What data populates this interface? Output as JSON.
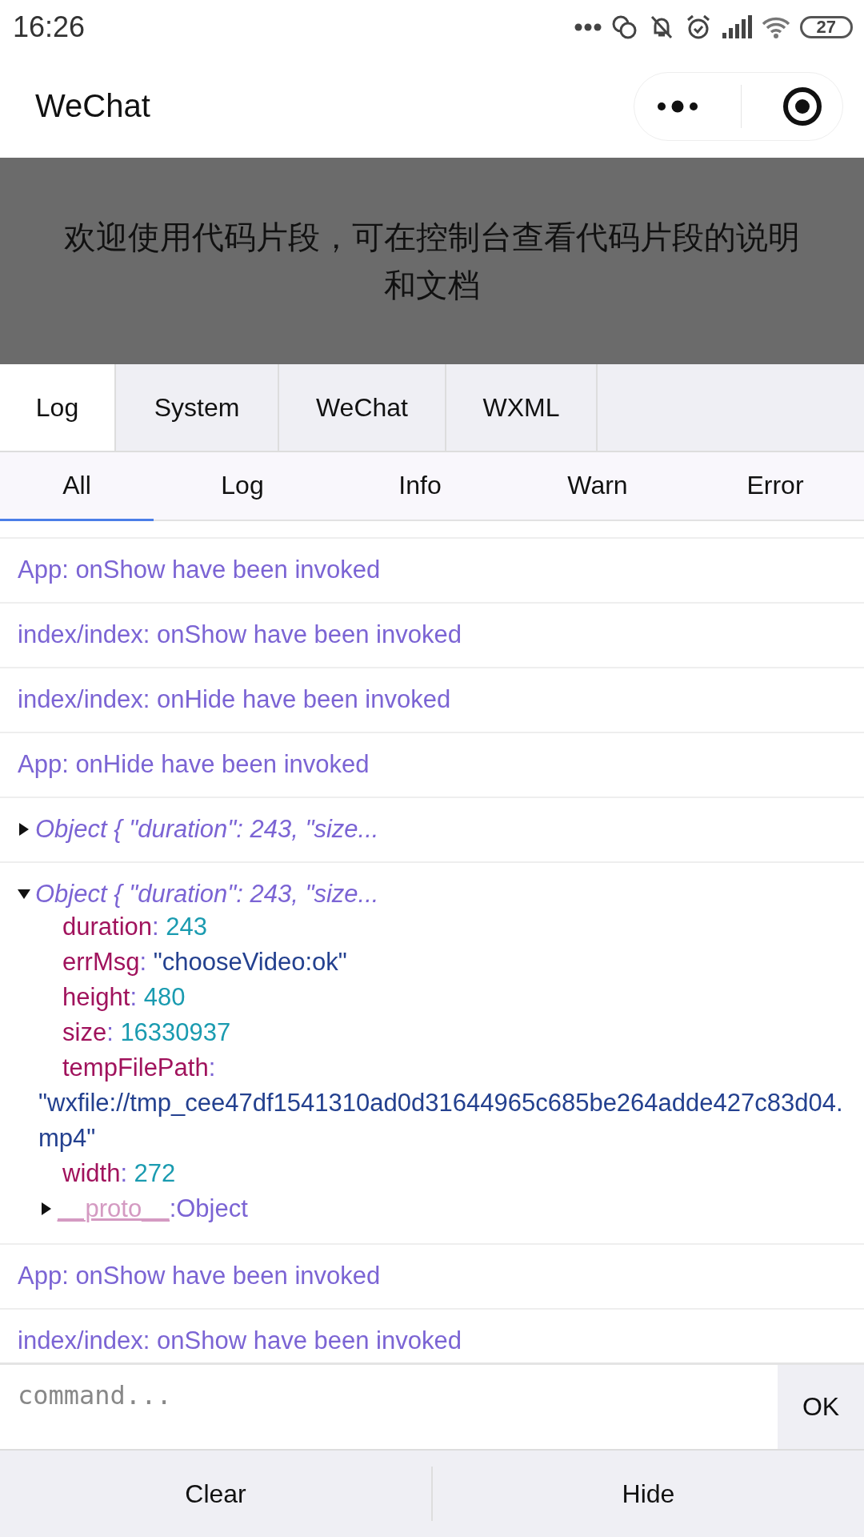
{
  "status_bar": {
    "time": "16:26",
    "battery": "27"
  },
  "nav": {
    "title": "WeChat"
  },
  "banner": {
    "text": "欢迎使用代码片段，可在控制台查看代码片段的说明和文档"
  },
  "tabs": [
    {
      "label": "Log",
      "selected": true
    },
    {
      "label": "System",
      "selected": false
    },
    {
      "label": "WeChat",
      "selected": false
    },
    {
      "label": "WXML",
      "selected": false
    }
  ],
  "filters": [
    {
      "label": "All",
      "selected": true
    },
    {
      "label": "Log",
      "selected": false
    },
    {
      "label": "Info",
      "selected": false
    },
    {
      "label": "Warn",
      "selected": false
    },
    {
      "label": "Error",
      "selected": false
    }
  ],
  "logs": [
    {
      "kind": "text",
      "text": "App: onShow have been invoked"
    },
    {
      "kind": "text",
      "text": "index/index: onShow have been invoked"
    },
    {
      "kind": "text",
      "text": "index/index: onHide have been invoked"
    },
    {
      "kind": "text",
      "text": "App: onHide have been invoked"
    },
    {
      "kind": "object",
      "summary": "Object { \"duration\": 243, \"size...",
      "expanded": false
    },
    {
      "kind": "object",
      "summary": "Object { \"duration\": 243, \"size...",
      "expanded": true,
      "properties": [
        {
          "kind": "number",
          "key": "duration",
          "colon": ":",
          "value": "243"
        },
        {
          "kind": "string",
          "key": "errMsg",
          "colon": ":",
          "value": "\"chooseVideo:ok\""
        },
        {
          "kind": "number",
          "key": "height",
          "colon": ":",
          "value": "480"
        },
        {
          "kind": "number",
          "key": "size",
          "colon": ":",
          "value": "16330937"
        },
        {
          "kind": "long_string",
          "key": "tempFilePath",
          "colon": ":",
          "value": "\"wxfile://tmp_cee47df1541310ad0d31644965c685be264adde427c83d04.mp4\""
        },
        {
          "kind": "number",
          "key": "width",
          "colon": ":",
          "value": "272"
        },
        {
          "kind": "proto",
          "key": "__proto__",
          "colon": ":",
          "value": "Object",
          "expanded": false
        }
      ]
    },
    {
      "kind": "text",
      "text": "App: onShow have been invoked"
    },
    {
      "kind": "text",
      "text": "index/index: onShow have been invoked"
    }
  ],
  "command": {
    "placeholder": "command...",
    "button": "OK"
  },
  "footer": [
    "Clear",
    "Hide"
  ]
}
